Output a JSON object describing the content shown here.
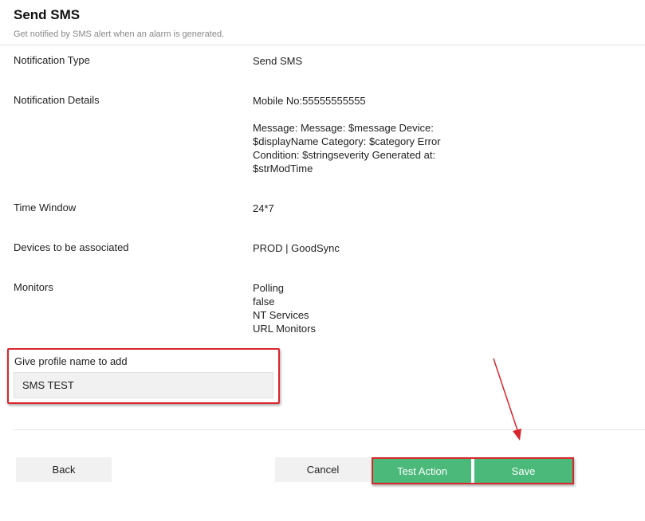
{
  "header": {
    "title": "Send SMS",
    "subtitle": "Get notified by SMS alert when an alarm is generated."
  },
  "details": {
    "notification_type": {
      "label": "Notification Type",
      "value": "Send SMS"
    },
    "notification_details": {
      "label": "Notification Details",
      "mobile": "Mobile No:55555555555",
      "message_lines": [
        "Message: Message: $message Device:",
        "$displayName Category: $category Error",
        "Condition: $stringseverity Generated at:",
        "$strModTime"
      ]
    },
    "time_window": {
      "label": "Time Window",
      "value": "24*7"
    },
    "devices": {
      "label": "Devices to be associated",
      "value": "PROD | GoodSync"
    },
    "monitors": {
      "label": "Monitors",
      "values": [
        "Polling",
        "false",
        "NT Services",
        "URL Monitors"
      ]
    }
  },
  "profile": {
    "label": "Give profile name to add",
    "value": "SMS TEST"
  },
  "buttons": {
    "back": "Back",
    "cancel": "Cancel",
    "test_action": "Test Action",
    "save": "Save"
  },
  "colors": {
    "accent_green": "#4ab97a",
    "highlight_red": "#d9262b"
  }
}
